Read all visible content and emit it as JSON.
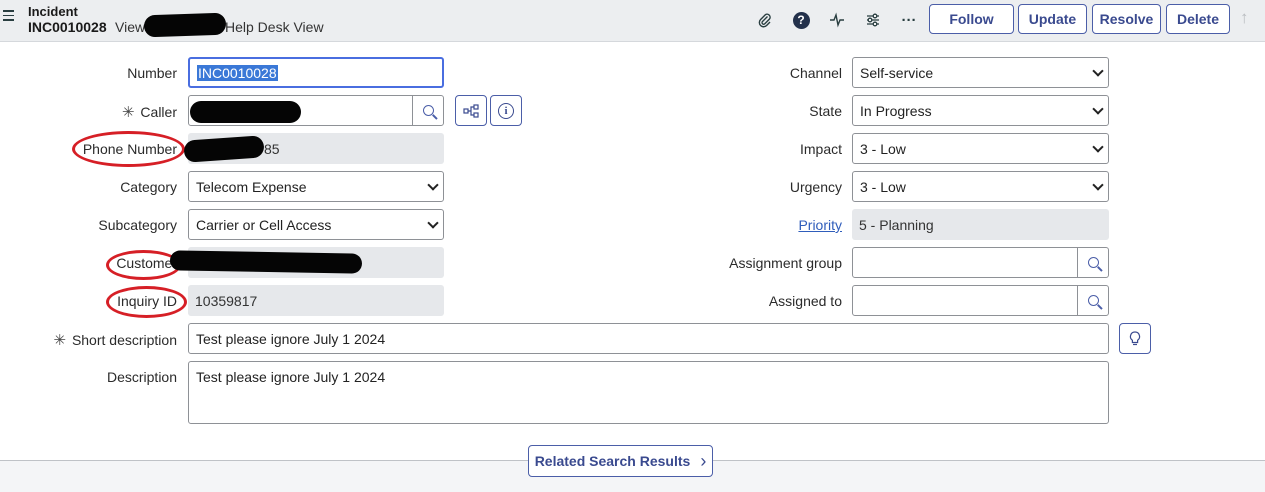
{
  "header": {
    "record_type": "Incident",
    "record_number": "INC0010028",
    "view_prefix": "View:",
    "view_name": "Help Desk View",
    "buttons": {
      "follow": "Follow",
      "update": "Update",
      "resolve": "Resolve",
      "delete": "Delete"
    },
    "icons": [
      "paperclip-icon",
      "help-icon",
      "activity-icon",
      "settings-sliders-icon",
      "more-icon",
      "scroll-up-icon"
    ]
  },
  "form": {
    "left": {
      "number": {
        "label": "Number",
        "value": "INC0010028"
      },
      "caller": {
        "label": "Caller",
        "required": "✳"
      },
      "phone_number": {
        "label": "Phone Number",
        "value_suffix": "85"
      },
      "category": {
        "label": "Category",
        "value": "Telecom Expense"
      },
      "subcategory": {
        "label": "Subcategory",
        "value": "Carrier or Cell Access"
      },
      "customer": {
        "label": "Customer"
      },
      "inquiry_id": {
        "label": "Inquiry ID",
        "value": "10359817"
      }
    },
    "right": {
      "channel": {
        "label": "Channel",
        "value": "Self-service"
      },
      "state": {
        "label": "State",
        "value": "In Progress"
      },
      "impact": {
        "label": "Impact",
        "value": "3 - Low"
      },
      "urgency": {
        "label": "Urgency",
        "value": "3 - Low"
      },
      "priority": {
        "label": "Priority",
        "value": "5 - Planning"
      },
      "assignment_group": {
        "label": "Assignment group",
        "value": ""
      },
      "assigned_to": {
        "label": "Assigned to",
        "value": ""
      }
    },
    "short_description": {
      "label": "Short description",
      "required": "✳",
      "value": "Test please ignore July 1 2024"
    },
    "description": {
      "label": "Description",
      "value": "Test please ignore July 1 2024"
    }
  },
  "footer": {
    "related_search": "Related Search Results",
    "related_chevron": "›"
  },
  "colors": {
    "accent": "#4b5ea8",
    "annotation_circle": "#d61f26",
    "readonly_bg": "#e6e8eb",
    "header_bg": "#eceef0"
  }
}
